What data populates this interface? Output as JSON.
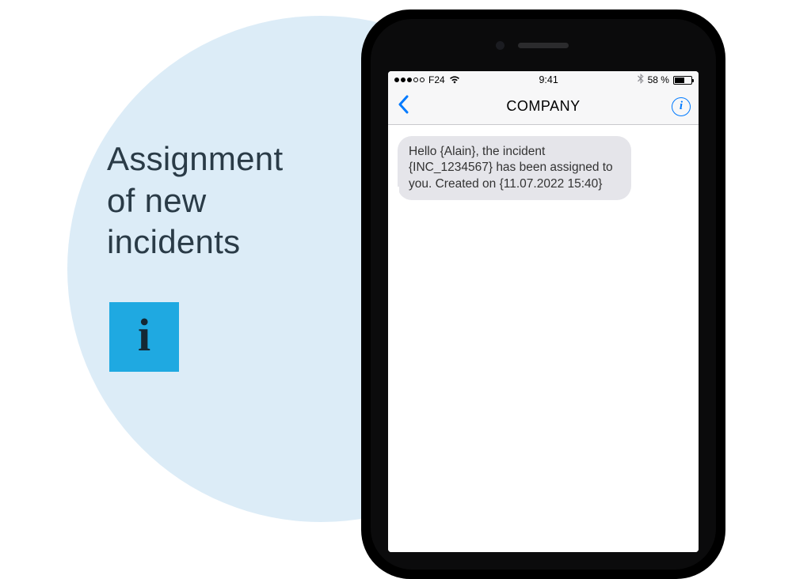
{
  "headline": {
    "line1": "Assignment",
    "line2": "of new",
    "line3": "incidents"
  },
  "info_glyph": "i",
  "phone": {
    "status": {
      "carrier": "F24",
      "time": "9:41",
      "battery_pct": "58 %"
    },
    "nav": {
      "title": "COMPANY",
      "info_glyph": "i"
    },
    "message": "Hello {Alain}, the incident {INC_1234567} has been assigned  to you. Created on {11.07.2022 15:40}"
  }
}
